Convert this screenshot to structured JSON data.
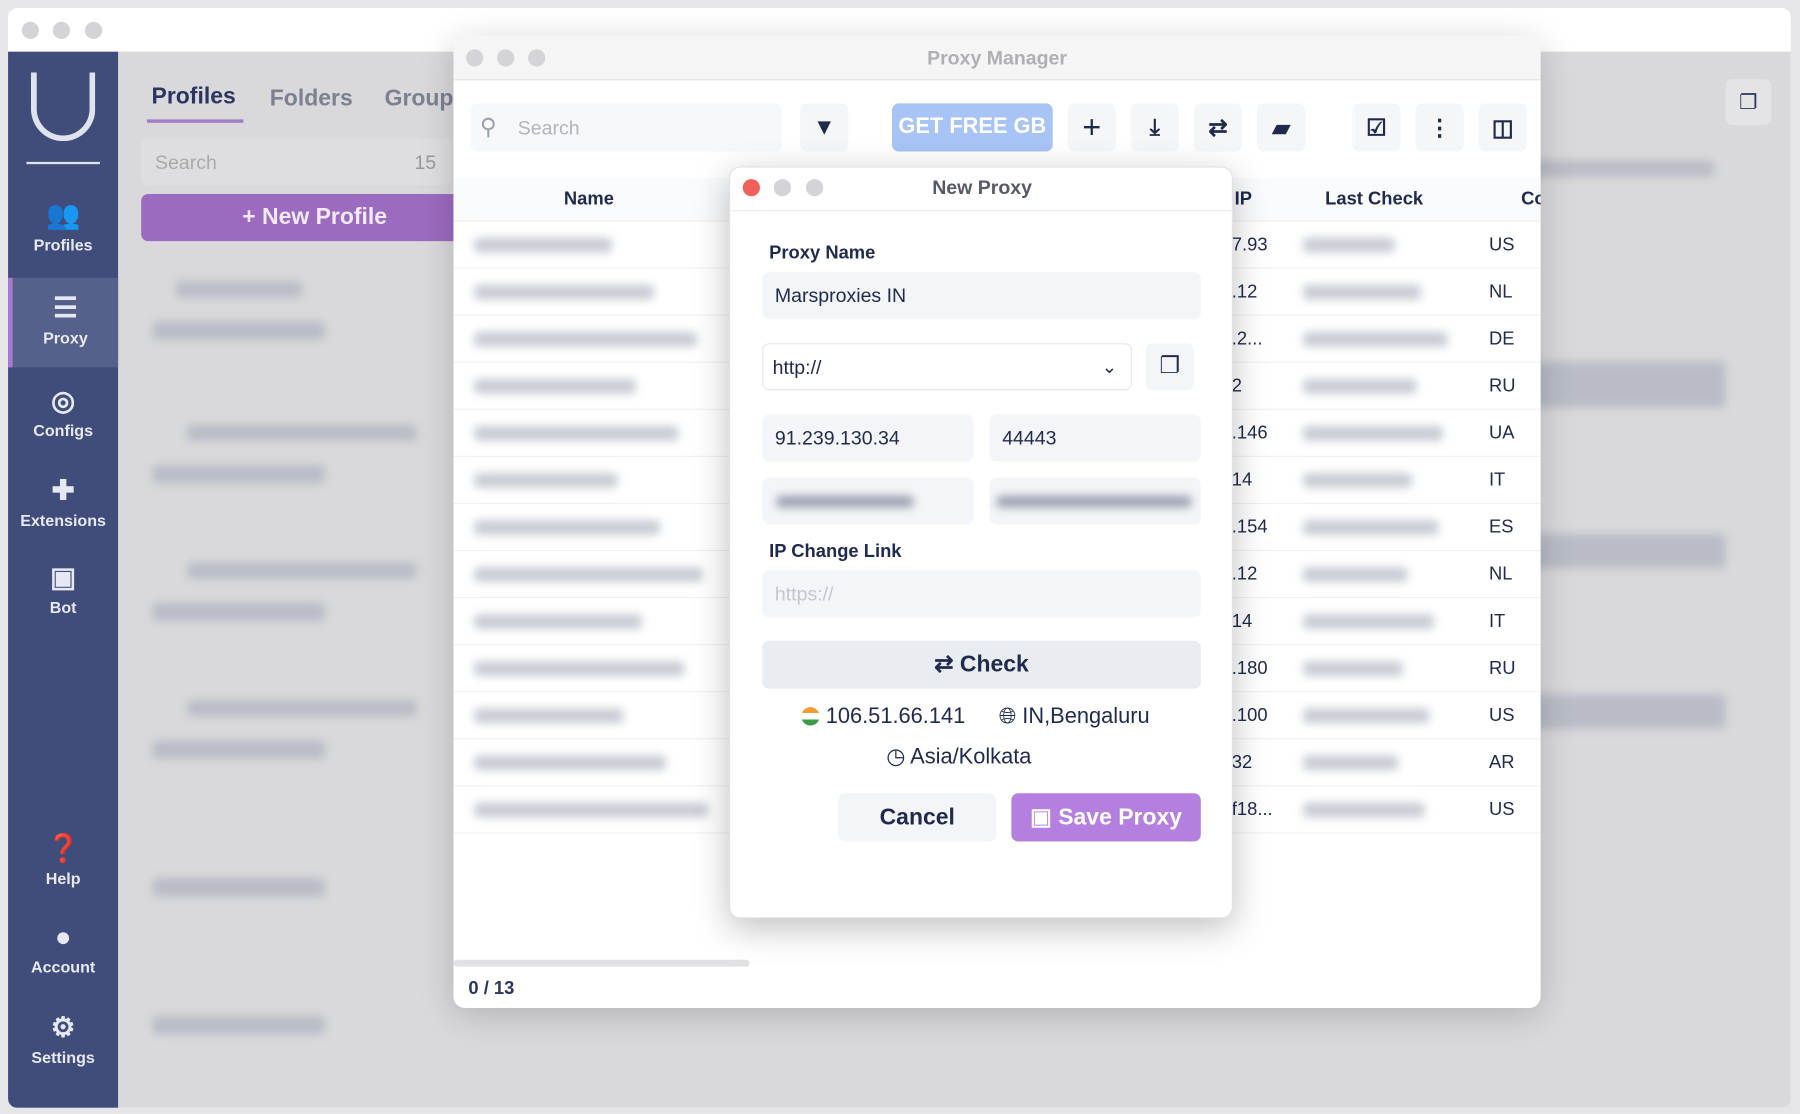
{
  "app": {
    "sidebar": {
      "items": [
        {
          "label": "Profiles",
          "icon": "users-gear-icon",
          "active": false
        },
        {
          "label": "Proxy",
          "icon": "server-icon",
          "active": true
        },
        {
          "label": "Configs",
          "icon": "fingerprint-icon",
          "active": false
        },
        {
          "label": "Extensions",
          "icon": "puzzle-icon",
          "active": false
        },
        {
          "label": "Bot",
          "icon": "robot-icon",
          "active": false
        },
        {
          "label": "Help",
          "icon": "question-icon",
          "active": false
        },
        {
          "label": "Account",
          "icon": "user-circle-icon",
          "active": false
        },
        {
          "label": "Settings",
          "icon": "gear-icon",
          "active": false
        }
      ]
    },
    "tabs": [
      "Profiles",
      "Folders",
      "Groups"
    ],
    "search_placeholder": "Search",
    "profile_count": "15",
    "new_profile": "+ New Profile",
    "accent": "#9b6bc0"
  },
  "proxy_manager": {
    "title": "Proxy Manager",
    "search_placeholder": "Search",
    "free_gb": "GET FREE GB",
    "columns": [
      "Name",
      "IP",
      "Last Check",
      "Co"
    ],
    "rows": [
      {
        "ip": "7.93",
        "country": "US"
      },
      {
        "ip": ".12",
        "country": "NL"
      },
      {
        "ip": ".2...",
        "country": "DE"
      },
      {
        "ip": "2",
        "country": "RU"
      },
      {
        "ip": ".146",
        "country": "UA"
      },
      {
        "ip": "14",
        "country": "IT"
      },
      {
        "ip": ".154",
        "country": "ES"
      },
      {
        "ip": ".12",
        "country": "NL"
      },
      {
        "ip": "14",
        "country": "IT"
      },
      {
        "ip": ".180",
        "country": "RU"
      },
      {
        "ip": ".100",
        "country": "US"
      },
      {
        "ip": "32",
        "country": "AR"
      },
      {
        "ip": "f18...",
        "country": "US"
      }
    ],
    "footer": "0 / 13"
  },
  "dialog": {
    "title": "New Proxy",
    "proxy_name_label": "Proxy Name",
    "proxy_name": "Marsproxies IN",
    "protocol": "http://",
    "host": "91.239.130.34",
    "port": "44443",
    "ip_change_label": "IP Change Link",
    "ip_change_placeholder": "https://",
    "check": "Check",
    "result_ip": "106.51.66.141",
    "result_location": "IN,Bengaluru",
    "result_timezone": "Asia/Kolkata",
    "cancel": "Cancel",
    "save": "Save Proxy",
    "save_color": "#b57fe0"
  }
}
